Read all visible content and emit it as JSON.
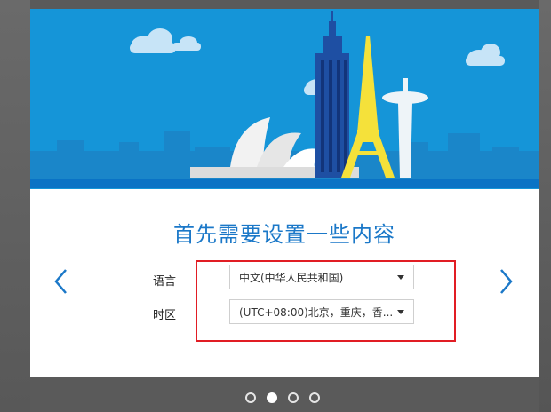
{
  "setup": {
    "title": "首先需要设置一些内容",
    "language": {
      "label": "语言",
      "value": "中文(中华人民共和国)"
    },
    "timezone": {
      "label": "时区",
      "value": "(UTC+08:00)北京，重庆，香..."
    }
  },
  "pager": {
    "current": 2,
    "total": 4
  },
  "icons": {
    "prev": "chevron-left-icon",
    "next": "chevron-right-icon",
    "dropdown": "caret-down-icon"
  },
  "colors": {
    "hero_bg": "#1595d8",
    "title": "#1b78c8",
    "highlight": "#e11d24",
    "nav_arrow": "#1b78c8"
  }
}
